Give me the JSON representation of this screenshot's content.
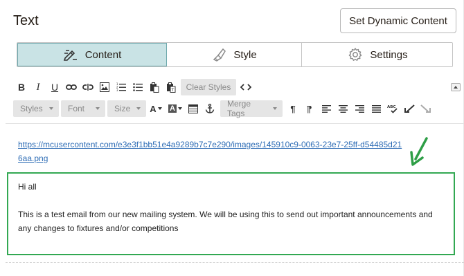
{
  "panel": {
    "title": "Text",
    "dynamic_button": "Set Dynamic Content"
  },
  "tabs": [
    {
      "label": "Content",
      "icon": "edit-icon",
      "active": true
    },
    {
      "label": "Style",
      "icon": "brush-icon",
      "active": false
    },
    {
      "label": "Settings",
      "icon": "gear-icon",
      "active": false
    }
  ],
  "toolbar": {
    "clear_styles": "Clear Styles",
    "styles": "Styles",
    "font": "Font",
    "size": "Size",
    "merge_tags": "Merge Tags"
  },
  "content": {
    "link": "https://mcusercontent.com/e3e3f1bb51e4a9289b7c7e290/images/145910c9-0063-23e7-25ff-d54485d216aa.png",
    "greeting": "Hi all",
    "body": "This is a test email from our new mailing system. We will be using this to send out important announcements and any changes to fixtures and/or competitions"
  },
  "colors": {
    "active_tab_bg": "#c9e3e5",
    "highlight_border": "#32a852",
    "link": "#2d6cb5"
  }
}
